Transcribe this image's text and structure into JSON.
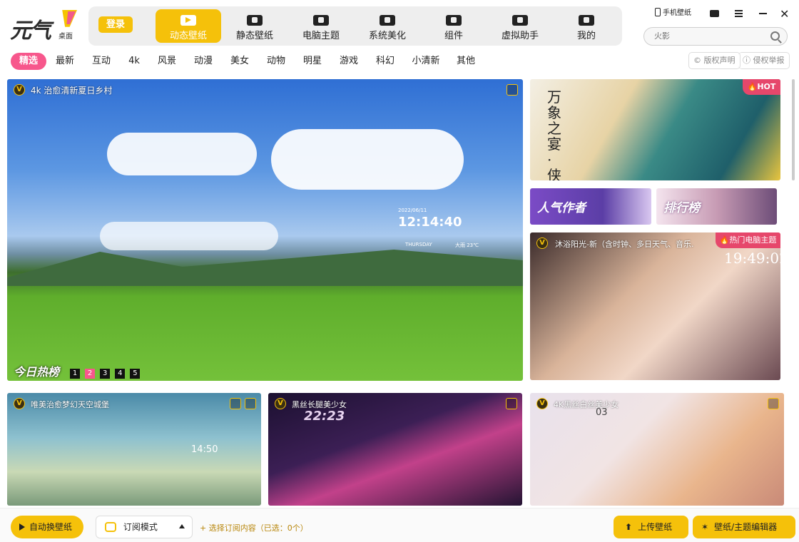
{
  "app": {
    "logo_text": "元气",
    "logo_sub": "桌面"
  },
  "header": {
    "login_label": "登录",
    "nav": [
      {
        "label": "动态壁纸",
        "icon": "play-screen-icon",
        "active": true
      },
      {
        "label": "静态壁纸",
        "icon": "picture-icon"
      },
      {
        "label": "电脑主题",
        "icon": "tshirt-icon"
      },
      {
        "label": "系统美化",
        "icon": "flower-icon"
      },
      {
        "label": "组件",
        "icon": "widget-icon"
      },
      {
        "label": "虚拟助手",
        "icon": "paw-icon"
      },
      {
        "label": "我的",
        "icon": "face-icon"
      }
    ],
    "phone_wallpaper": "手机壁纸",
    "search_placeholder": "火影"
  },
  "categories": [
    "精选",
    "最新",
    "互动",
    "4k",
    "风景",
    "动漫",
    "美女",
    "动物",
    "明星",
    "游戏",
    "科幻",
    "小清新",
    "其他"
  ],
  "rights": {
    "copyright": "版权声明",
    "report": "侵权举报"
  },
  "hero": {
    "title": "4k 治愈清新夏日乡村",
    "ranking_label": "今日热榜",
    "pages": [
      "1",
      "2",
      "3",
      "4",
      "5"
    ],
    "active_page": "2",
    "clock": "12:14:40",
    "date": "2022/06/11",
    "weekday": "THURSDAY",
    "weather": "大雨 23℃"
  },
  "side": {
    "banner_badge": "HOT",
    "banner_text": "万象之宴·侠",
    "popular_author": "人气作者",
    "ranking": "排行榜",
    "theme_title": "沐浴阳光-新（含时钟、多日天气、音乐.",
    "theme_badge": "热门电脑主题",
    "theme_clock": "19:49:02"
  },
  "cards": [
    {
      "title": "唯美治愈梦幻天空城堡",
      "clock": "14:50"
    },
    {
      "title": "黑丝长腿美少女",
      "clock": "22:23"
    },
    {
      "title": "4K黑丝白丝美少女",
      "clock": "03"
    }
  ],
  "bottom": {
    "auto_change": "自动换壁纸",
    "subscribe_mode": "订阅模式",
    "subscribe_content": "+ 选择订阅内容（已选：0个）",
    "upload": "上传壁纸",
    "editor": "壁纸/主题编辑器"
  },
  "colors": {
    "accent": "#f5c10a",
    "pink": "#f7578c"
  }
}
